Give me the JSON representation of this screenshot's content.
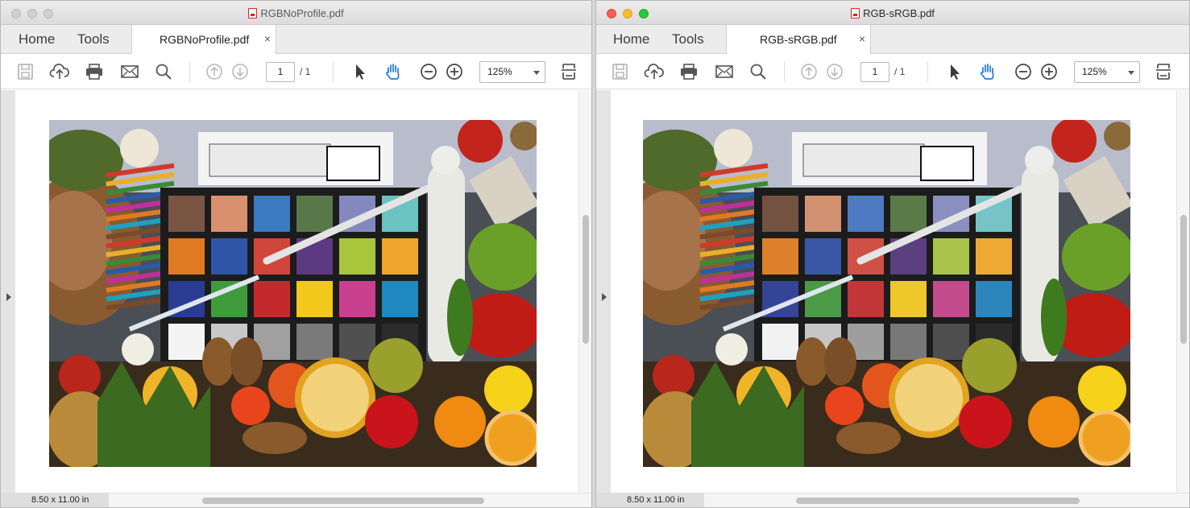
{
  "left_window": {
    "title": "RGBNoProfile.pdf",
    "nav_home": "Home",
    "nav_tools": "Tools",
    "tab_label": "RGBNoProfile.pdf",
    "tab_close": "×",
    "page_current": "1",
    "page_total": "/ 1",
    "zoom": "125%",
    "page_size": "8.50 x 11.00 in"
  },
  "right_window": {
    "title": "RGB-sRGB.pdf",
    "nav_home": "Home",
    "nav_tools": "Tools",
    "tab_label": "RGB-sRGB.pdf",
    "tab_close": "×",
    "page_current": "1",
    "page_total": "/ 1",
    "zoom": "125%",
    "page_size": "8.50 x 11.00 in"
  },
  "toolbar_icons": [
    "save-icon",
    "upload-icon",
    "print-icon",
    "mail-icon",
    "search-icon",
    "page-up-icon",
    "page-down-icon",
    "select-arrow-icon",
    "hand-tool-icon",
    "zoom-out-icon",
    "zoom-in-icon",
    "fit-page-icon"
  ],
  "colors": {
    "accent_hand": "#2a7fd4",
    "window_bg": "#ececec"
  },
  "color_checker": {
    "left": [
      "#7a5543",
      "#d9906f",
      "#3b79c0",
      "#59784a",
      "#8489bd",
      "#6ac3c0",
      "#e07a22",
      "#2f55a8",
      "#d0463c",
      "#5c3a82",
      "#a8c63c",
      "#f0a52a",
      "#2a3c92",
      "#3f9c3c",
      "#c42a2c",
      "#f2c81a",
      "#c8408e",
      "#1f88be",
      "#f4f4f4",
      "#c8c8c8",
      "#a0a0a0",
      "#7a7a7a",
      "#505050",
      "#2c2c2c"
    ],
    "right": [
      "#735242",
      "#d29271",
      "#4d7ac0",
      "#5a7a48",
      "#8b8fc0",
      "#76c4c6",
      "#de7f2c",
      "#3a57a6",
      "#cf5046",
      "#5b3f80",
      "#a9c44a",
      "#ecaa35",
      "#344595",
      "#4a9a47",
      "#c13638",
      "#eec72b",
      "#c24c8e",
      "#2c86bb",
      "#f2f2f2",
      "#c6c6c6",
      "#9e9e9e",
      "#787878",
      "#4e4e4e",
      "#2a2a2a"
    ]
  }
}
